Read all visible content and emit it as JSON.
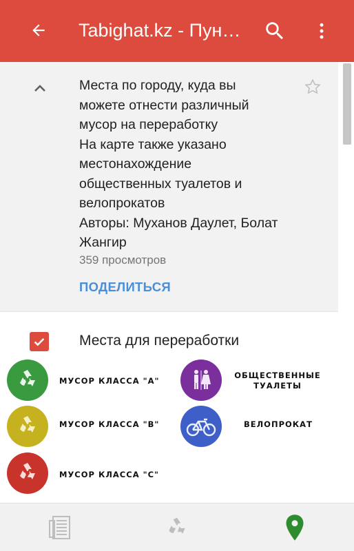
{
  "appbar": {
    "title": "Tabighat.kz - Пун…",
    "back_icon": "arrow-back-icon",
    "search_icon": "search-icon",
    "more_icon": "more-vert-icon",
    "background_color": "#dd4b3e"
  },
  "info": {
    "description_lines": [
      "Места по городу, куда вы",
      "можете отнести различный",
      "мусор на переработку",
      "На карте также указано",
      "местонахождение",
      "общественных туалетов и",
      "велопрокатов",
      "Авторы: Муханов Даулет, Болат",
      "Жангир"
    ],
    "views": "359 просмотров",
    "share_label": "ПОДЕЛИТЬСЯ",
    "star_icon": "star-outline-icon",
    "collapse_icon": "chevron-up-icon"
  },
  "layer": {
    "checked": true,
    "label": "Места для переработки"
  },
  "legend": {
    "items": [
      {
        "label": "МУСОР КЛАССА \"А\"",
        "icon": "recycle-icon",
        "color": "#3a9a3f"
      },
      {
        "label": "МУСОР КЛАССА \"В\"",
        "icon": "recycle-icon",
        "color": "#c6b21f"
      },
      {
        "label": "МУСОР КЛАССА \"С\"",
        "icon": "recycle-icon",
        "color": "#c8342b"
      },
      {
        "label": "ОБЩЕСТВЕННЫЕ ТУАЛЕТЫ",
        "label_line1": "ОБЩЕСТВЕННЫЕ",
        "label_line2": "ТУАЛЕТЫ",
        "icon": "restroom-icon",
        "color": "#7b2f9c"
      },
      {
        "label": "ВЕЛОПРОКАТ",
        "icon": "bicycle-icon",
        "color": "#3f5fc8"
      }
    ]
  },
  "bottom_nav": {
    "tabs": [
      {
        "icon": "list-icon",
        "active": false
      },
      {
        "icon": "recycle-icon",
        "active": false
      },
      {
        "icon": "map-pin-icon",
        "active": true,
        "color": "#2e8b2e"
      }
    ]
  }
}
